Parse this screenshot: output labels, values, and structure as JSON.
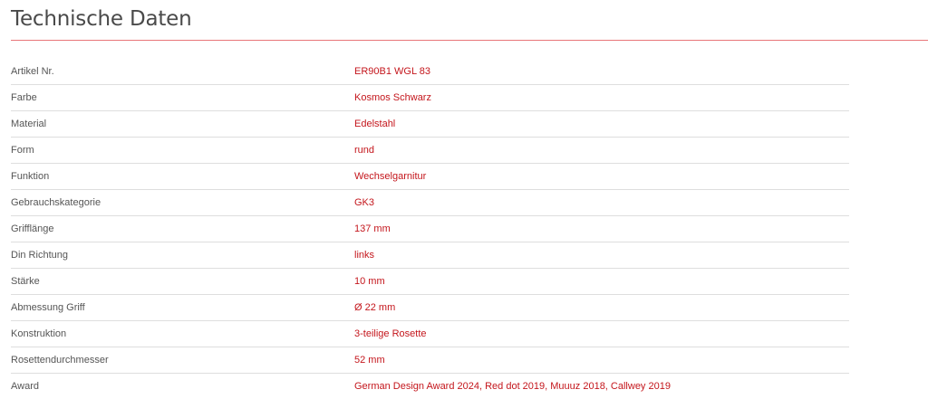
{
  "section": {
    "title": "Technische Daten"
  },
  "specs": [
    {
      "label": "Artikel Nr.",
      "value": "ER90B1 WGL 83"
    },
    {
      "label": "Farbe",
      "value": "Kosmos Schwarz"
    },
    {
      "label": "Material",
      "value": "Edelstahl"
    },
    {
      "label": "Form",
      "value": "rund"
    },
    {
      "label": "Funktion",
      "value": "Wechselgarnitur"
    },
    {
      "label": "Gebrauchskategorie",
      "value": "GK3"
    },
    {
      "label": "Grifflänge",
      "value": "137 mm"
    },
    {
      "label": "Din Richtung",
      "value": "links"
    },
    {
      "label": "Stärke",
      "value": "10 mm"
    },
    {
      "label": "Abmessung Griff",
      "value": "Ø 22 mm"
    },
    {
      "label": "Konstruktion",
      "value": "3-teilige Rosette"
    },
    {
      "label": "Rosettendurchmesser",
      "value": "52 mm"
    },
    {
      "label": "Award",
      "value": "German Design Award 2024, Red dot 2019, Muuuz 2018, Callwey 2019"
    }
  ],
  "colors": {
    "accent_rule": "#e8767a",
    "value_text": "#c4161c",
    "label_text": "#555555",
    "title_text": "#4a4a4a"
  }
}
